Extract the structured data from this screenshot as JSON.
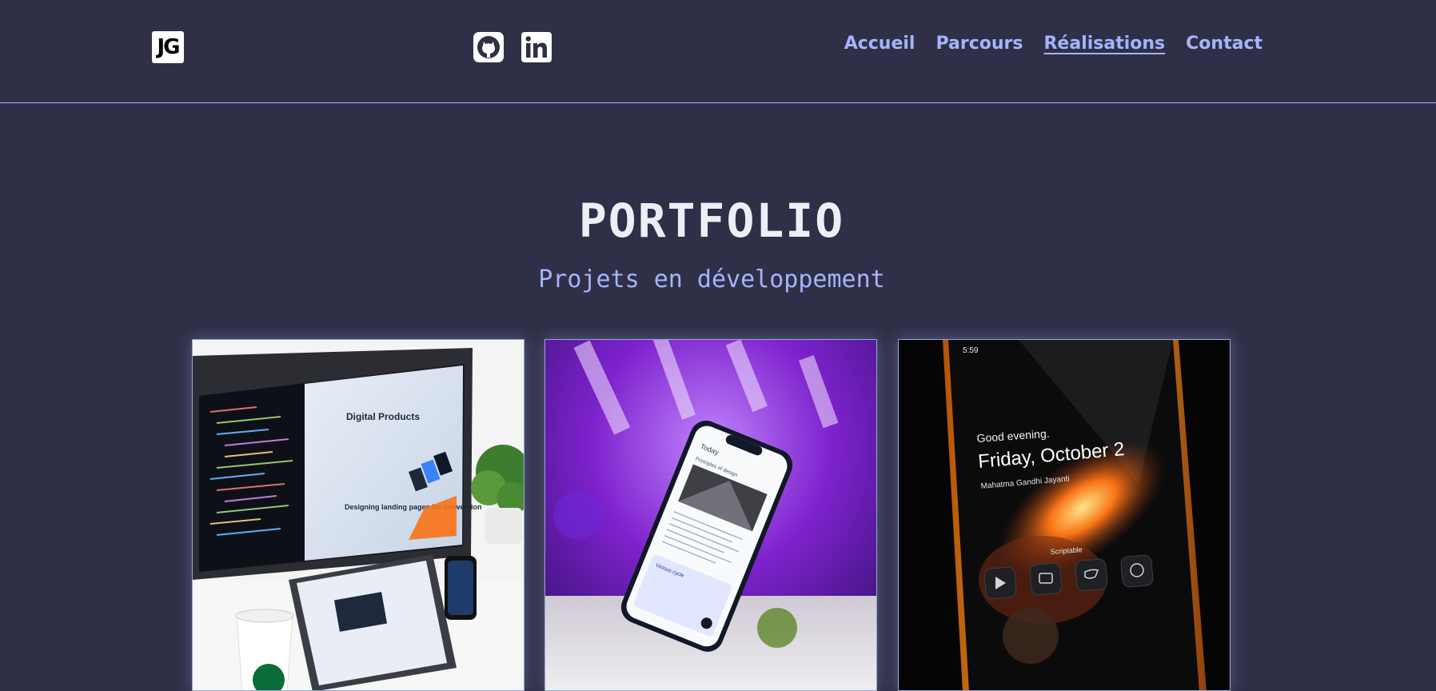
{
  "header": {
    "logo_text": "JG",
    "social": [
      {
        "name": "github-icon"
      },
      {
        "name": "linkedin-icon"
      }
    ],
    "nav": [
      {
        "label": "Accueil",
        "active": false
      },
      {
        "label": "Parcours",
        "active": false
      },
      {
        "label": "Réalisations",
        "active": true
      },
      {
        "label": "Contact",
        "active": false
      }
    ]
  },
  "main": {
    "title": "PORTFOLIO",
    "subtitle": "Projets en développement"
  },
  "cards": [
    {
      "screen_title": "Digital Products",
      "screen_tagline": "Designing landing pages for conversion"
    },
    {
      "screen_title": "Today",
      "screen_heading": "Principles of design",
      "screen_section": "Vicious cycle"
    },
    {
      "time": "5:59",
      "greeting": "Good evening.",
      "date": "Friday, October 2",
      "event": "Mahatma Gandhi Jayanti",
      "app": "Scriptable"
    }
  ],
  "colors": {
    "background": "#2f3047",
    "accent": "#a5b4fc",
    "title": "#eceff4"
  }
}
